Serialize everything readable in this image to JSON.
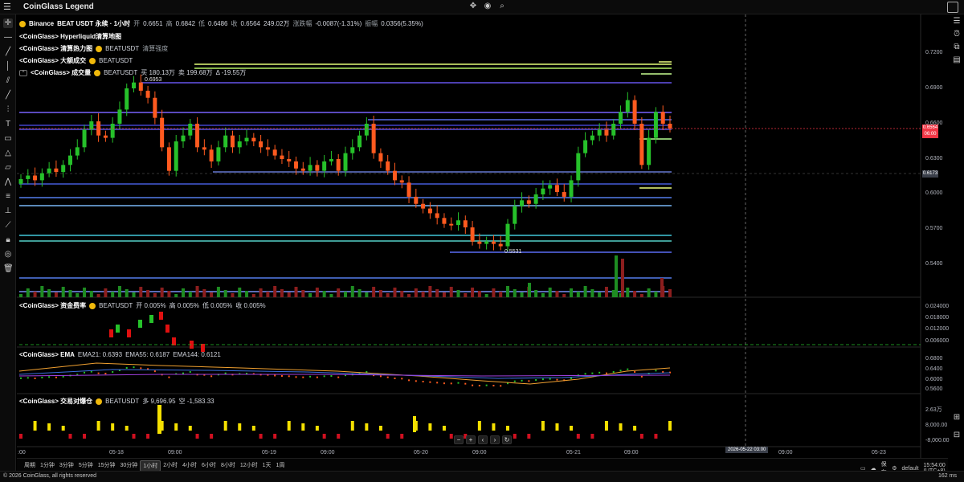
{
  "app": {
    "title": "CoinGlass Legend"
  },
  "main_legend": {
    "exchange": "Binance",
    "symbol": "BEAT USDT 永续 · 1小时",
    "open_label": "开",
    "open": "0.6651",
    "high_label": "高",
    "high": "0.6842",
    "low_label": "低",
    "low": "0.6486",
    "close_label": "收",
    "close": "0.6564",
    "volume": "249.02万",
    "change_label": "涨跌幅",
    "change": "-0.0087(-1.31%)",
    "amplitude_label": "振幅",
    "amplitude": "0.0356(5.35%)"
  },
  "indicators": {
    "hyperliquid": "<CoinGlass> Hyperliquid清算地图",
    "liq_heatmap": "<CoinGlass> 清算热力图",
    "liq_heatmap_symbol": "BEATUSDT",
    "liq_heatmap_extra": "清算强度",
    "big_trades": "<CoinGlass> 大额成交",
    "big_trades_symbol": "BEATUSDT",
    "volume": "<CoinGlass> 成交量",
    "volume_symbol": "BEATUSDT",
    "volume_buy": "买 180.13万",
    "volume_sell": "卖 199.68万",
    "volume_delta": "Δ -19.55万",
    "funding": "<CoinGlass> 资金费率",
    "funding_symbol": "BEATUSDT",
    "funding_open": "开 0.005%",
    "funding_high": "高 0.005%",
    "funding_low": "低 0.005%",
    "funding_close": "收 0.005%",
    "ema": "<CoinGlass> EMA",
    "ema21": "EMA21: 0.6393",
    "ema55": "EMA55: 0.6187",
    "ema144": "EMA144: 0.6121",
    "taker": "<CoinGlass> 交易对爆仓",
    "taker_symbol": "BEATUSDT",
    "taker_long": "多 9,696.95",
    "taker_short": "空 -1,583.33"
  },
  "price_axis": [
    "0.7200",
    "0.6900",
    "0.6600",
    "0.6300",
    "0.6000",
    "0.5700",
    "0.5400"
  ],
  "price_tags": {
    "current": "0.6564",
    "countdown": "06:00",
    "cross": "0.6173"
  },
  "annotations": {
    "high_marker": "0.6953",
    "low_marker": "0.5531"
  },
  "funding_axis": [
    "0.024000",
    "0.018000",
    "0.012000",
    "0.006000"
  ],
  "ema_axis": [
    "0.6800",
    "0.6400",
    "0.6000",
    "0.5600"
  ],
  "taker_axis": [
    "2.63万",
    "8,000.00",
    "-8,000.00"
  ],
  "time_axis": [
    ":00",
    "05-18",
    "09:00",
    "05-19",
    "09:00",
    "05-20",
    "09:00",
    "05-21",
    "09:00",
    "09:00",
    "05-23"
  ],
  "hover_date": "2026-05-22 03:00",
  "intervals": [
    "周期",
    "1分钟",
    "3分钟",
    "5分钟",
    "15分钟",
    "30分钟",
    "1小时",
    "2小时",
    "4小时",
    "6小时",
    "8小时",
    "12小时",
    "1天",
    "1周"
  ],
  "active_interval": "1小时",
  "settings": {
    "save": "保存",
    "layout": "default",
    "clock": "15:54:00 (UTC+8)"
  },
  "footer": {
    "copyright": "© 2026 CoinGlass, all rights reserved",
    "ping": "162 ms"
  },
  "colors": {
    "up": "#26c12a",
    "down": "#ff5a1f",
    "bg": "#000000",
    "current_price": "#f23645"
  },
  "chart_data": {
    "type": "candlestick",
    "interval": "1h",
    "ylim": [
      0.53,
      0.725
    ],
    "candles_close_approx": [
      0.613,
      0.616,
      0.612,
      0.618,
      0.622,
      0.619,
      0.625,
      0.633,
      0.64,
      0.655,
      0.662,
      0.65,
      0.648,
      0.66,
      0.672,
      0.69,
      0.695,
      0.688,
      0.682,
      0.665,
      0.64,
      0.62,
      0.645,
      0.65,
      0.66,
      0.64,
      0.638,
      0.628,
      0.64,
      0.65,
      0.64,
      0.645,
      0.648,
      0.645,
      0.64,
      0.638,
      0.633,
      0.63,
      0.628,
      0.622,
      0.62,
      0.625,
      0.62,
      0.628,
      0.63,
      0.62,
      0.635,
      0.64,
      0.65,
      0.66,
      0.635,
      0.628,
      0.62,
      0.612,
      0.61,
      0.598,
      0.592,
      0.588,
      0.584,
      0.58,
      0.575,
      0.574,
      0.578,
      0.572,
      0.56,
      0.558,
      0.56,
      0.558,
      0.556,
      0.575,
      0.59,
      0.595,
      0.592,
      0.6,
      0.605,
      0.608,
      0.602,
      0.598,
      0.612,
      0.635,
      0.646,
      0.65,
      0.655,
      0.65,
      0.66,
      0.67,
      0.68,
      0.66,
      0.625,
      0.648,
      0.67,
      0.66,
      0.656
    ]
  }
}
